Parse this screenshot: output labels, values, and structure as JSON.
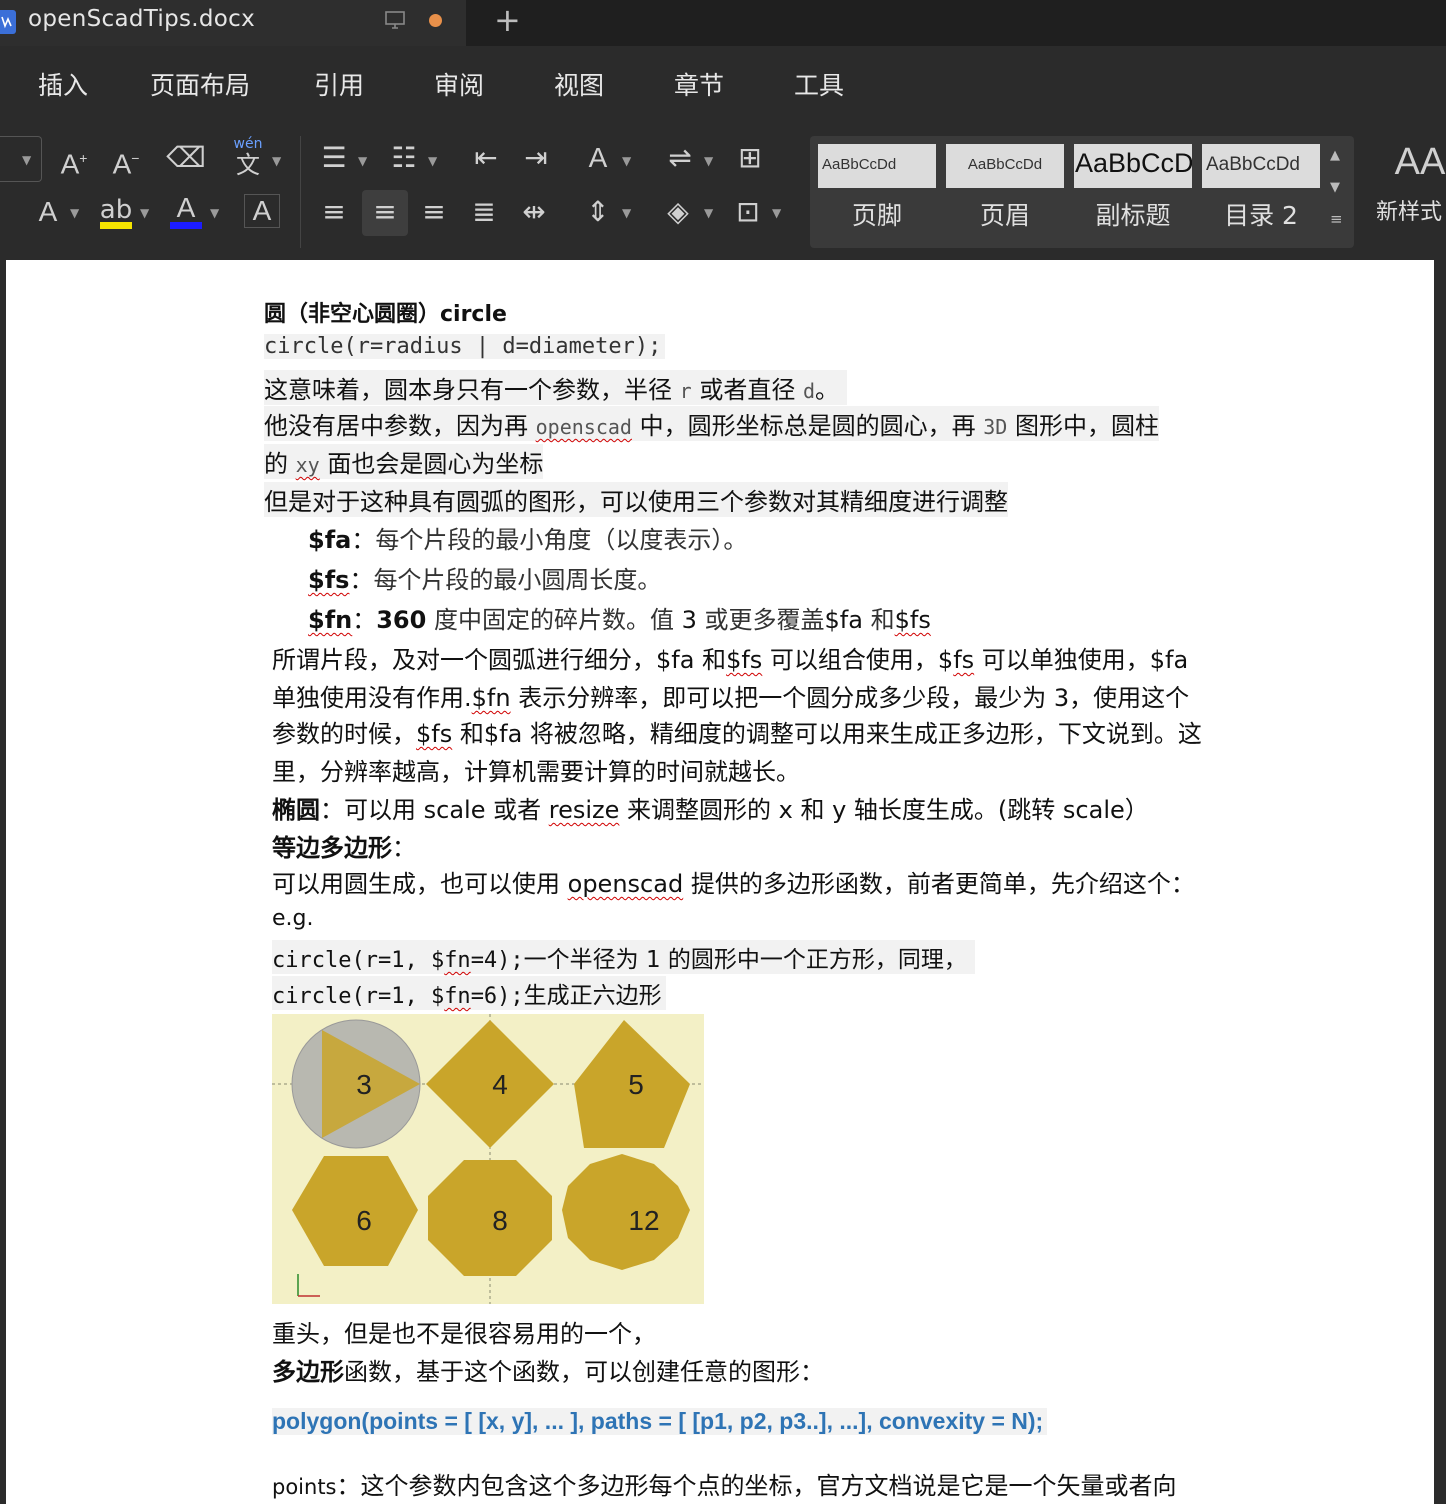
{
  "window": {
    "tab_title": "openScadTips.docx",
    "new_tab": "+"
  },
  "menu": [
    "插入",
    "页面布局",
    "引用",
    "审阅",
    "视图",
    "章节",
    "工具"
  ],
  "ribbon": {
    "styles": [
      {
        "sample": "AaBbCcDd",
        "name": "页脚"
      },
      {
        "sample": "AaBbCcDd",
        "name": "页眉"
      },
      {
        "sample": "AaBbCcD",
        "name": "副标题"
      },
      {
        "sample": "AaBbCcDd",
        "name": "目录 2"
      }
    ],
    "new_style": "新样式",
    "pinyin_label": "wén",
    "pinyin_char": "文"
  },
  "doc": {
    "heading": "圆（非空心圆圈）circle",
    "sig": "circle(r=radius | d=diameter);",
    "p1": {
      "a": "这意味着，圆本身只有一个参数，半径 ",
      "b": "r",
      "c": " 或者直径 ",
      "d": "d",
      "e": "。"
    },
    "p2": {
      "a": "他没有居中参数，因为再 ",
      "b": "openscad",
      "c": " 中，圆形坐标总是圆的圆心，再 ",
      "d": "3D",
      "e": " 图形中，圆柱"
    },
    "p3": {
      "a": "的 ",
      "b": "xy",
      "c": " 面也会是圆心为坐标"
    },
    "p4": "但是对于这种具有圆弧的图形，可以使用三个参数对其精细度进行调整",
    "fa": {
      "name": "$fa",
      "sep": "：",
      "text": "每个片段的最小角度（以度表示）。"
    },
    "fs": {
      "name": "$fs",
      "sep": "：",
      "text": "每个片段的最小圆周长度。"
    },
    "fn": {
      "name": "$fn",
      "sep": "：",
      "num": "360",
      "t1": " 度中固定的碎片数。值 ",
      "three": "3",
      "t2": " 或更多覆盖",
      "fa": "$fa",
      "he": " 和",
      "fs": "$fs"
    },
    "para1": {
      "a": "所谓片段，及对一个圆弧进行细分，$fa 和",
      "b": "$fs",
      "c": " 可以组合使用，$",
      "d": "fs",
      "e": " 可以单独使用，$fa"
    },
    "para2": {
      "a": "单独使用没有作用.",
      "b": "$fn",
      "c": " 表示分辨率，即可以把一个圆分成多少段，最少为 3，使用这个"
    },
    "para3": {
      "a": "参数的时候，",
      "b": "$fs",
      "c": " 和$fa 将被忽略，精细度的调整可以用来生成正多边形，下文说到。这"
    },
    "para4": "里，分辨率越高，计算机需要计算的时间就越长。",
    "ellipse": {
      "label": "椭圆",
      "a": "：可以用 scale 或者 ",
      "b": "resize",
      "c": " 来调整圆形的 x 和 y 轴长度生成。(跳转 scale）"
    },
    "poly_title": {
      "label": "等边多边形",
      "sep": "："
    },
    "poly_desc": {
      "a": "可以用圆生成，也可以使用 ",
      "b": "openscad",
      "c": " 提供的多边形函数，前者更简单，先介绍这个："
    },
    "eg": "e.g.",
    "ex1": {
      "a": "circle(r=1, $",
      "b": "fn",
      "c": "=4);",
      "d": "一个半径为 1 的圆形中一个正方形，同理，"
    },
    "ex2": {
      "a": "circle(r=1, $",
      "b": "fn",
      "c": "=6);",
      "d": "生成正六边形"
    },
    "shape_labels": [
      "3",
      "4",
      "5",
      "6",
      "8",
      "12"
    ],
    "after_img": "重头，但是也不是很容易用的一个，",
    "polygon_fn": {
      "label": "多边形",
      "text": "函数，基于这个函数，可以创建任意的图形："
    },
    "polygon_sig": "polygon(points = [ [x, y], ... ], paths = [ [p1, p2, p3..], ...], convexity = N);",
    "points": {
      "a": "points",
      "b": "：这个参数内包含这个多边形每个点的坐标，官方文档说是它是一个矢量或者向"
    }
  }
}
